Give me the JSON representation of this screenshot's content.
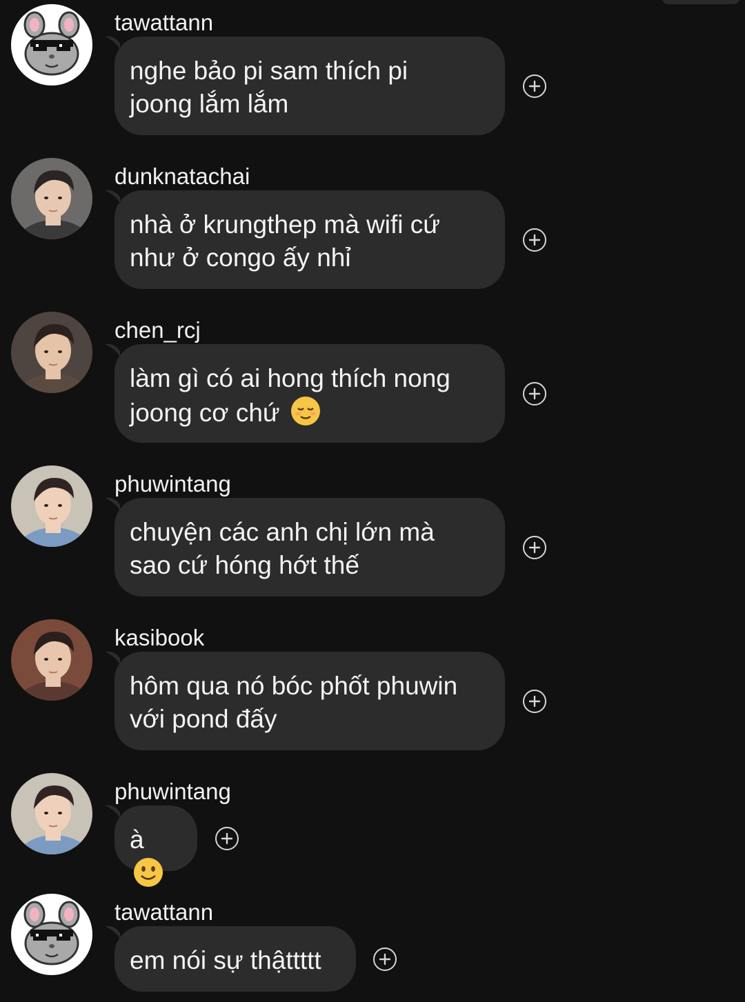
{
  "colors": {
    "background": "#111111",
    "bubble": "#2c2c2c",
    "text": "#f4f4f4"
  },
  "messages": [
    {
      "username": "tawattann",
      "avatar": "chinchilla-sunglasses-avatar",
      "lines": [
        "nghe bảo pi sam thích pi",
        "joong lắm lắm"
      ],
      "emoji": ""
    },
    {
      "username": "dunknatachai",
      "avatar": "profile-photo-avatar",
      "lines": [
        "nhà ở krungthep mà wifi cứ",
        "như ở congo ấy nhỉ"
      ],
      "emoji": ""
    },
    {
      "username": "chen_rcj",
      "avatar": "profile-photo-avatar",
      "lines": [
        "làm gì có ai hong thích nong",
        "joong cơ chứ"
      ],
      "emoji": "relieved-face"
    },
    {
      "username": "phuwintang",
      "avatar": "profile-photo-avatar",
      "lines": [
        "chuyện các anh chị lớn mà",
        "sao cứ hóng hớt thế"
      ],
      "emoji": ""
    },
    {
      "username": "kasibook",
      "avatar": "profile-photo-avatar",
      "lines": [
        "hôm qua nó bóc phốt phuwin",
        "với pond đấy"
      ],
      "emoji": ""
    },
    {
      "username": "phuwintang",
      "avatar": "profile-photo-avatar",
      "lines": [
        "à"
      ],
      "emoji": "slightly-smiling-face"
    },
    {
      "username": "tawattann",
      "avatar": "chinchilla-sunglasses-avatar",
      "lines": [
        "em nói sự thậttttt"
      ],
      "emoji": ""
    }
  ]
}
